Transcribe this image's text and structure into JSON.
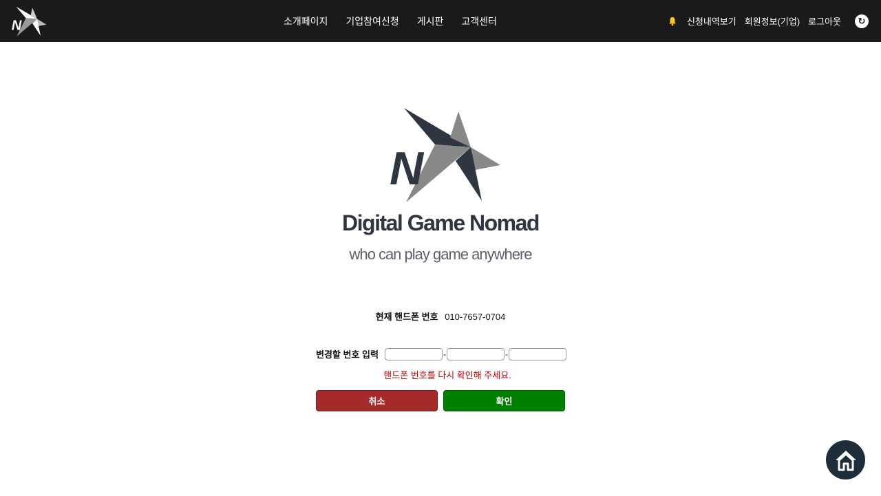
{
  "nav": {
    "items": [
      {
        "label": "소개페이지"
      },
      {
        "label": "기업참여신청"
      },
      {
        "label": "게시판"
      },
      {
        "label": "고객센터"
      }
    ],
    "right": {
      "applications": "신청내역보기",
      "member_info": "회원정보(기업)",
      "logout": "로그아웃",
      "refresh_icon": "↻"
    }
  },
  "brand": {
    "title": "Digital Game Nomad",
    "subtitle": "who can play game anywhere",
    "logo_letter": "N"
  },
  "form": {
    "current_label": "현재 핸드폰 번호",
    "current_value": "010-7657-0704",
    "change_label": "변경할 번호 입력",
    "inputs": [
      {
        "value": "",
        "placeholder": ""
      },
      {
        "value": "",
        "placeholder": ""
      },
      {
        "value": "",
        "placeholder": ""
      }
    ],
    "dash": "-",
    "error": "핸드폰 번호를 다시 확인해 주세요.",
    "cancel_label": "취소",
    "confirm_label": "확인"
  },
  "icons": {
    "bell": "bell-icon",
    "refresh": "refresh-icon",
    "home": "home-icon"
  },
  "colors": {
    "topbar": "#1a1a1a",
    "cancel": "#a52a2a",
    "confirm": "#008000",
    "error": "#c00000",
    "brand_dark": "#2f3541",
    "brand_gray": "#888888",
    "bell": "#f5c518"
  }
}
